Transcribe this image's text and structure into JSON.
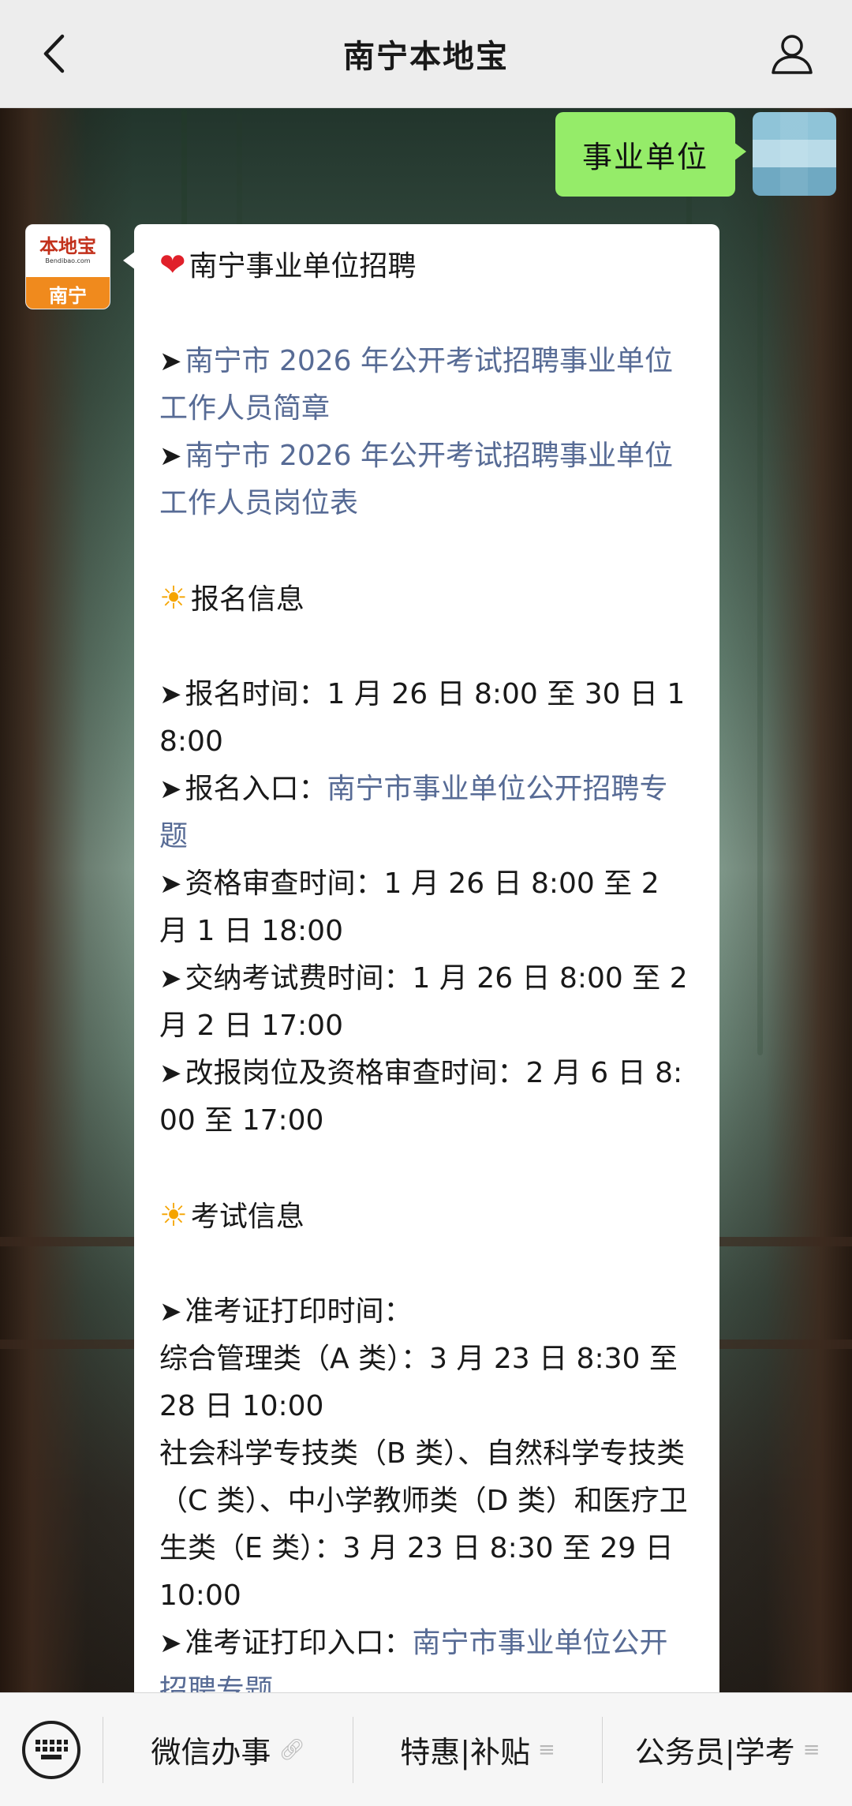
{
  "header": {
    "title": "南宁本地宝",
    "back_icon": "chevron-left-icon",
    "profile_icon": "user-icon"
  },
  "outgoing": {
    "text": "事业单位"
  },
  "bot": {
    "logo_brand": "本地宝",
    "logo_url": "Bendibao.com",
    "logo_city": "南宁"
  },
  "message": {
    "title": "南宁事业单位招聘",
    "links_top": [
      "南宁市 2026 年公开考试招聘事业单位工作人员简章",
      "南宁市 2026 年公开考试招聘事业单位工作人员岗位表"
    ],
    "reg_heading": "报名信息",
    "reg_time": "报名时间：1 月 26 日 8:00 至 30 日 18:00",
    "reg_entry_label": "报名入口：",
    "reg_entry_link": "南宁市事业单位公开招聘专题",
    "review_time": "资格审查时间：1 月 26 日 8:00 至 2 月 1 日 18:00",
    "fee_time": "交纳考试费时间：1 月 26 日 8:00 至 2 月 2 日 17:00",
    "change_time": "改报岗位及资格审查时间：2 月 6 日 8:00 至 17:00",
    "exam_heading": "考试信息",
    "admit_time_label": "准考证打印时间：",
    "admit_a": "综合管理类（A 类）：3 月 23 日 8:30 至 28 日 10:00",
    "admit_bcde": "社会科学专技类（B 类）、自然科学专技类（C 类）、中小学教师类（D 类）和医疗卫生类（E 类）：3 月 23 日 8:30 至 29 日 10:00",
    "admit_entry_label": "准考证打印入口：",
    "admit_entry_link": "南宁市事业单位公开招聘专题"
  },
  "menu": {
    "keyboard_icon": "keyboard-icon",
    "items": [
      {
        "label": "微信办事",
        "icon": "link-icon"
      },
      {
        "label": "特惠|补贴",
        "icon": "menu-icon"
      },
      {
        "label": "公务员|学考",
        "icon": "menu-icon"
      }
    ]
  },
  "colors": {
    "link": "#576b95",
    "outgoing_bubble": "#95ec69",
    "navbar": "#ededed"
  }
}
